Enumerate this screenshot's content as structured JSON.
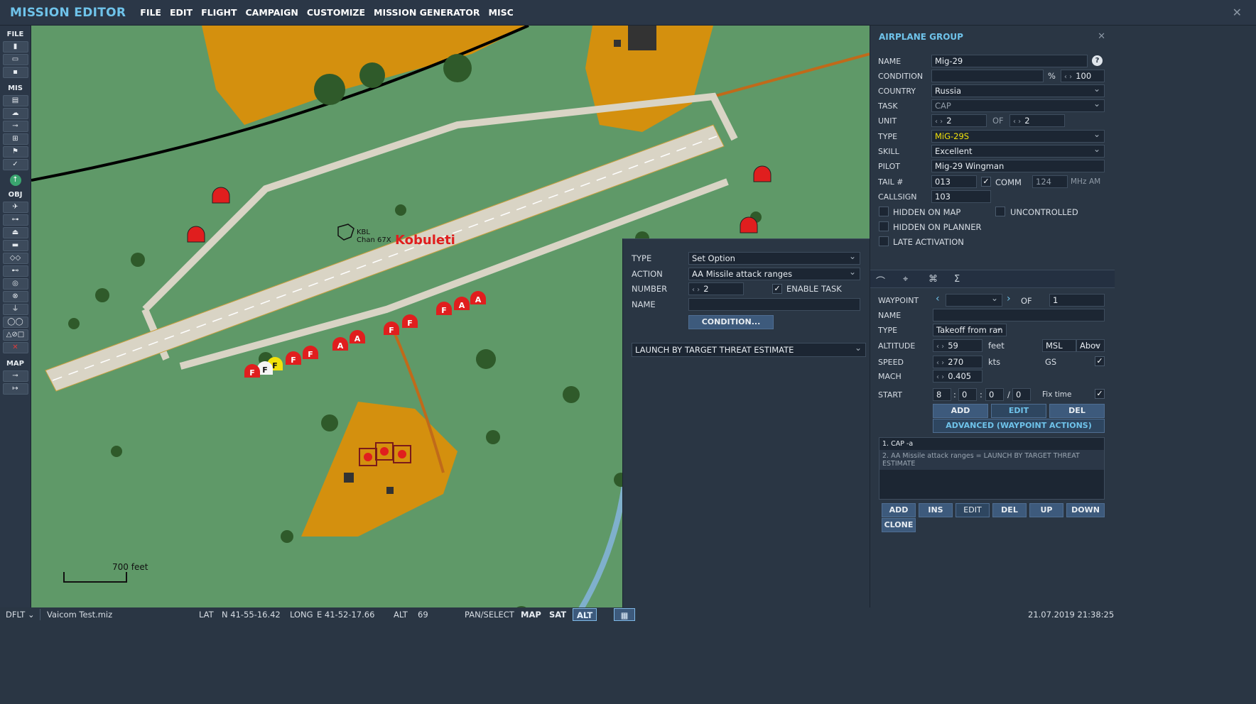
{
  "menubar": {
    "title": "MISSION EDITOR",
    "items": [
      "FILE",
      "EDIT",
      "FLIGHT",
      "CAMPAIGN",
      "CUSTOMIZE",
      "MISSION GENERATOR",
      "MISC"
    ]
  },
  "left_toolbar": {
    "file_label": "FILE",
    "mis_label": "MIS",
    "obj_label": "OBJ",
    "map_label": "MAP"
  },
  "map": {
    "airfield_name": "Kobuleti",
    "airfield_code": "KBL",
    "airfield_channel": "Chan 67X",
    "scale_label": "700 feet",
    "colors": {
      "grass": "#5f9968",
      "urban": "#d4900e",
      "runway": "#d9d4c5",
      "water": "#7fb0cc",
      "shelter": "#e01e1e"
    }
  },
  "action_panel": {
    "type_label": "TYPE",
    "type_value": "Set Option",
    "action_label": "ACTION",
    "action_value": "AA Missile attack ranges",
    "number_label": "NUMBER",
    "number_value": "2",
    "enable_task_label": "ENABLE TASK",
    "name_label": "NAME",
    "condition_button": "CONDITION...",
    "launch_value": "LAUNCH BY TARGET THREAT ESTIMATE"
  },
  "group_panel": {
    "title": "AIRPLANE GROUP",
    "name_label": "NAME",
    "name_value": "Mig-29",
    "condition_label": "CONDITION",
    "condition_percent": "%",
    "condition_value": "100",
    "country_label": "COUNTRY",
    "country_value": "Russia",
    "task_label": "TASK",
    "task_value": "CAP",
    "unit_label": "UNIT",
    "unit_value": "2",
    "unit_of": "OF",
    "unit_total": "2",
    "type_label": "TYPE",
    "type_value": "MiG-29S",
    "skill_label": "SKILL",
    "skill_value": "Excellent",
    "pilot_label": "PILOT",
    "pilot_value": "Mig-29 Wingman",
    "tail_label": "TAIL #",
    "tail_value": "013",
    "comm_label": "COMM",
    "comm_value": "124",
    "comm_unit": "MHz",
    "comm_mod": "AM",
    "callsign_label": "CALLSIGN",
    "callsign_value": "103",
    "hidden_map_label": "HIDDEN ON MAP",
    "uncontrolled_label": "UNCONTROLLED",
    "hidden_planner_label": "HIDDEN ON PLANNER",
    "late_activation_label": "LATE ACTIVATION"
  },
  "waypoint_panel": {
    "waypoint_label": "WAYPOINT",
    "waypoint_of": "OF",
    "waypoint_total": "1",
    "name_label": "NAME",
    "type_label": "TYPE",
    "type_value": "Takeoff from ran",
    "altitude_label": "ALTITUDE",
    "altitude_value": "59",
    "altitude_unit": "feet",
    "altitude_ref": "MSL",
    "altitude_above": "Abov",
    "speed_label": "SPEED",
    "speed_value": "270",
    "speed_unit": "kts",
    "speed_ref": "GS",
    "mach_label": "MACH",
    "mach_value": "0.405",
    "start_label": "START",
    "start_d": "8",
    "start_h": "0",
    "start_m": "0",
    "start_s": "0",
    "fix_time_label": "Fix time",
    "add_btn": "ADD",
    "edit_btn": "EDIT",
    "del_btn": "DEL",
    "advanced_btn": "ADVANCED (WAYPOINT ACTIONS)",
    "actions": [
      "1. CAP -a",
      "2. AA Missile attack ranges = LAUNCH BY TARGET THREAT ESTIMATE"
    ],
    "list_buttons": [
      "ADD",
      "INS",
      "EDIT",
      "DEL",
      "UP",
      "DOWN"
    ],
    "clone_btn": "CLONE"
  },
  "statusbar": {
    "profile": "DFLT",
    "file": "Vaicom Test.miz",
    "lat_label": "LAT",
    "lat_value": "N 41-55-16.42",
    "long_label": "LONG",
    "long_value": "E 41-52-17.66",
    "alt_label": "ALT",
    "alt_value": "69",
    "mode": "PAN/SELECT",
    "map_btn": "MAP",
    "sat_btn": "SAT",
    "alt_btn": "ALT",
    "datetime": "21.07.2019 21:38:25"
  }
}
